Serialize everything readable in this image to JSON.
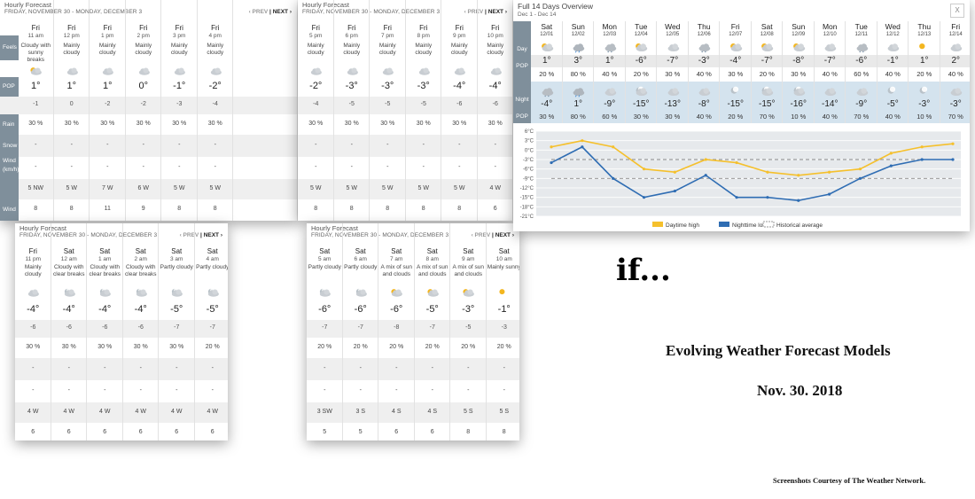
{
  "common": {
    "title": "Hourly Forecast",
    "subtitle": "FRIDAY, NOVEMBER 30 - MONDAY, DECEMBER 3",
    "prev": "‹ PREV",
    "next": "NEXT ›"
  },
  "labels": {
    "feels": "Feels like",
    "pop": "POP",
    "rain": "Rain",
    "snow": "Snow",
    "wind": "Wind (km/h)",
    "gust": "Wind gust (km/h)"
  },
  "p1": {
    "cols": [
      {
        "day": "Fri",
        "time": "11 am",
        "cond": "Cloudy with sunny breaks",
        "icon": "sun-cloud-icon",
        "temp": "1°",
        "feels": "-1",
        "pop": "30 %",
        "rain": "-",
        "snow": "-",
        "wind": "5 NW",
        "gust": "8"
      },
      {
        "day": "Fri",
        "time": "12 pm",
        "cond": "Mainly cloudy",
        "icon": "cloud-icon",
        "temp": "1°",
        "feels": "0",
        "pop": "30 %",
        "rain": "-",
        "snow": "-",
        "wind": "5 W",
        "gust": "8"
      },
      {
        "day": "Fri",
        "time": "1 pm",
        "cond": "Mainly cloudy",
        "icon": "cloud-icon",
        "temp": "1°",
        "feels": "-2",
        "pop": "30 %",
        "rain": "-",
        "snow": "-",
        "wind": "7 W",
        "gust": "11"
      },
      {
        "day": "Fri",
        "time": "2 pm",
        "cond": "Mainly cloudy",
        "icon": "cloud-icon",
        "temp": "0°",
        "feels": "-2",
        "pop": "30 %",
        "rain": "-",
        "snow": "-",
        "wind": "6 W",
        "gust": "9"
      },
      {
        "day": "Fri",
        "time": "3 pm",
        "cond": "Mainly cloudy",
        "icon": "cloud-icon",
        "temp": "-1°",
        "feels": "-3",
        "pop": "30 %",
        "rain": "-",
        "snow": "-",
        "wind": "5 W",
        "gust": "8"
      },
      {
        "day": "Fri",
        "time": "4 pm",
        "cond": "Mainly cloudy",
        "icon": "cloud-icon",
        "temp": "-2°",
        "feels": "-4",
        "pop": "30 %",
        "rain": "-",
        "snow": "-",
        "wind": "5 W",
        "gust": "8"
      }
    ]
  },
  "p2": {
    "cols": [
      {
        "day": "Fri",
        "time": "5 pm",
        "cond": "Mainly cloudy",
        "icon": "cloud-icon",
        "temp": "-2°",
        "feels": "-4",
        "pop": "30 %",
        "rain": "-",
        "snow": "-",
        "wind": "5 W",
        "gust": "8"
      },
      {
        "day": "Fri",
        "time": "6 pm",
        "cond": "Mainly cloudy",
        "icon": "cloud-icon",
        "temp": "-3°",
        "feels": "-5",
        "pop": "30 %",
        "rain": "-",
        "snow": "-",
        "wind": "5 W",
        "gust": "8"
      },
      {
        "day": "Fri",
        "time": "7 pm",
        "cond": "Mainly cloudy",
        "icon": "cloud-icon",
        "temp": "-3°",
        "feels": "-5",
        "pop": "30 %",
        "rain": "-",
        "snow": "-",
        "wind": "5 W",
        "gust": "8"
      },
      {
        "day": "Fri",
        "time": "8 pm",
        "cond": "Mainly cloudy",
        "icon": "cloud-icon",
        "temp": "-3°",
        "feels": "-5",
        "pop": "30 %",
        "rain": "-",
        "snow": "-",
        "wind": "5 W",
        "gust": "8"
      },
      {
        "day": "Fri",
        "time": "9 pm",
        "cond": "Mainly cloudy",
        "icon": "cloud-icon",
        "temp": "-4°",
        "feels": "-6",
        "pop": "30 %",
        "rain": "-",
        "snow": "-",
        "wind": "5 W",
        "gust": "8"
      },
      {
        "day": "Fri",
        "time": "10 pm",
        "cond": "Mainly cloudy",
        "icon": "cloud-icon",
        "temp": "-4°",
        "feels": "-6",
        "pop": "30 %",
        "rain": "-",
        "snow": "-",
        "wind": "4 W",
        "gust": "6"
      }
    ]
  },
  "p3": {
    "cols": [
      {
        "day": "Fri",
        "time": "11 pm",
        "cond": "Mainly cloudy",
        "icon": "cloud-icon",
        "temp": "-4°",
        "feels": "-6",
        "pop": "30 %",
        "rain": "-",
        "snow": "-",
        "wind": "4 W",
        "gust": "6"
      },
      {
        "day": "Sat",
        "time": "12 am",
        "cond": "Cloudy with clear breaks",
        "icon": "moon-cloud-icon",
        "temp": "-4°",
        "feels": "-6",
        "pop": "30 %",
        "rain": "-",
        "snow": "-",
        "wind": "4 W",
        "gust": "6"
      },
      {
        "day": "Sat",
        "time": "1 am",
        "cond": "Cloudy with clear breaks",
        "icon": "moon-cloud-icon",
        "temp": "-4°",
        "feels": "-6",
        "pop": "30 %",
        "rain": "-",
        "snow": "-",
        "wind": "4 W",
        "gust": "6"
      },
      {
        "day": "Sat",
        "time": "2 am",
        "cond": "Cloudy with clear breaks",
        "icon": "moon-cloud-icon",
        "temp": "-4°",
        "feels": "-6",
        "pop": "30 %",
        "rain": "-",
        "snow": "-",
        "wind": "4 W",
        "gust": "6"
      },
      {
        "day": "Sat",
        "time": "3 am",
        "cond": "Partly cloudy",
        "icon": "moon-cloud-icon",
        "temp": "-5°",
        "feels": "-7",
        "pop": "30 %",
        "rain": "-",
        "snow": "-",
        "wind": "4 W",
        "gust": "6"
      },
      {
        "day": "Sat",
        "time": "4 am",
        "cond": "Partly cloudy",
        "icon": "moon-cloud-icon",
        "temp": "-5°",
        "feels": "-7",
        "pop": "20 %",
        "rain": "-",
        "snow": "-",
        "wind": "4 W",
        "gust": "6"
      }
    ]
  },
  "p4": {
    "cols": [
      {
        "day": "Sat",
        "time": "5 am",
        "cond": "Partly cloudy",
        "icon": "moon-cloud-icon",
        "temp": "-6°",
        "feels": "-7",
        "pop": "20 %",
        "rain": "-",
        "snow": "-",
        "wind": "3 SW",
        "gust": "5"
      },
      {
        "day": "Sat",
        "time": "6 am",
        "cond": "Partly cloudy",
        "icon": "moon-cloud-icon",
        "temp": "-6°",
        "feels": "-7",
        "pop": "20 %",
        "rain": "-",
        "snow": "-",
        "wind": "3 S",
        "gust": "5"
      },
      {
        "day": "Sat",
        "time": "7 am",
        "cond": "A mix of sun and clouds",
        "icon": "sun-cloud-icon",
        "temp": "-6°",
        "feels": "-8",
        "pop": "20 %",
        "rain": "-",
        "snow": "-",
        "wind": "4 S",
        "gust": "6"
      },
      {
        "day": "Sat",
        "time": "8 am",
        "cond": "A mix of sun and clouds",
        "icon": "sun-cloud-icon",
        "temp": "-5°",
        "feels": "-7",
        "pop": "20 %",
        "rain": "-",
        "snow": "-",
        "wind": "4 S",
        "gust": "6"
      },
      {
        "day": "Sat",
        "time": "9 am",
        "cond": "A mix of sun and clouds",
        "icon": "sun-cloud-icon",
        "temp": "-3°",
        "feels": "-5",
        "pop": "20 %",
        "rain": "-",
        "snow": "-",
        "wind": "5 S",
        "gust": "8"
      },
      {
        "day": "Sat",
        "time": "10 am",
        "cond": "Mainly sunny",
        "icon": "sun-icon",
        "temp": "-1°",
        "feels": "-3",
        "pop": "20 %",
        "rain": "-",
        "snow": "-",
        "wind": "5 S",
        "gust": "8"
      }
    ]
  },
  "overview": {
    "title": "Full 14 Days Overview",
    "range": "Dec 1 - Dec 14",
    "close": "X",
    "day_label": "Day",
    "night_label": "Night",
    "pop_label": "POP",
    "days": [
      {
        "dow": "Sat",
        "date": "12/01",
        "day_icon": "sun-cloud-icon",
        "day_temp": "1°",
        "day_pop": "20 %",
        "night_icon": "snow-cloud-icon",
        "night_temp": "-4°",
        "night_pop": "30 %"
      },
      {
        "dow": "Sun",
        "date": "12/02",
        "day_icon": "rain-cloud-icon",
        "day_temp": "3°",
        "day_pop": "80 %",
        "night_icon": "rain-cloud-icon",
        "night_temp": "1°",
        "night_pop": "80 %"
      },
      {
        "dow": "Mon",
        "date": "12/03",
        "day_icon": "snow-cloud-icon",
        "day_temp": "1°",
        "day_pop": "40 %",
        "night_icon": "cloud-icon",
        "night_temp": "-9°",
        "night_pop": "60 %"
      },
      {
        "dow": "Tue",
        "date": "12/04",
        "day_icon": "sun-cloud-icon",
        "day_temp": "-6°",
        "day_pop": "20 %",
        "night_icon": "moon-cloud-icon",
        "night_temp": "-15°",
        "night_pop": "30 %"
      },
      {
        "dow": "Wed",
        "date": "12/05",
        "day_icon": "cloud-icon",
        "day_temp": "-7°",
        "day_pop": "30 %",
        "night_icon": "cloud-icon",
        "night_temp": "-13°",
        "night_pop": "30 %"
      },
      {
        "dow": "Thu",
        "date": "12/06",
        "day_icon": "snow-cloud-icon",
        "day_temp": "-3°",
        "day_pop": "40 %",
        "night_icon": "cloud-icon",
        "night_temp": "-8°",
        "night_pop": "40 %"
      },
      {
        "dow": "Fri",
        "date": "12/07",
        "day_icon": "sun-cloud-icon",
        "day_temp": "-4°",
        "day_pop": "30 %",
        "night_icon": "moon-icon",
        "night_temp": "-15°",
        "night_pop": "20 %"
      },
      {
        "dow": "Sat",
        "date": "12/08",
        "day_icon": "sun-cloud-icon",
        "day_temp": "-7°",
        "day_pop": "20 %",
        "night_icon": "moon-cloud-icon",
        "night_temp": "-15°",
        "night_pop": "70 %"
      },
      {
        "dow": "Sun",
        "date": "12/09",
        "day_icon": "sun-cloud-icon",
        "day_temp": "-8°",
        "day_pop": "30 %",
        "night_icon": "moon-cloud-icon",
        "night_temp": "-16°",
        "night_pop": "10 %"
      },
      {
        "dow": "Mon",
        "date": "12/10",
        "day_icon": "cloud-icon",
        "day_temp": "-7°",
        "day_pop": "40 %",
        "night_icon": "cloud-icon",
        "night_temp": "-14°",
        "night_pop": "40 %"
      },
      {
        "dow": "Tue",
        "date": "12/11",
        "day_icon": "snow-cloud-icon",
        "day_temp": "-6°",
        "day_pop": "60 %",
        "night_icon": "cloud-icon",
        "night_temp": "-9°",
        "night_pop": "70 %"
      },
      {
        "dow": "Wed",
        "date": "12/12",
        "day_icon": "cloud-icon",
        "day_temp": "-1°",
        "day_pop": "40 %",
        "night_icon": "moon-icon",
        "night_temp": "-5°",
        "night_pop": "40 %"
      },
      {
        "dow": "Thu",
        "date": "12/13",
        "day_icon": "sun-icon",
        "day_temp": "1°",
        "day_pop": "20 %",
        "night_icon": "moon-icon",
        "night_temp": "-3°",
        "night_pop": "10 %"
      },
      {
        "dow": "Fri",
        "date": "12/14",
        "day_icon": "cloud-icon",
        "day_temp": "2°",
        "day_pop": "40 %",
        "night_icon": "cloud-icon",
        "night_temp": "-3°",
        "night_pop": "70 %"
      }
    ]
  },
  "chart_data": {
    "type": "line",
    "x": [
      "12/01",
      "12/02",
      "12/03",
      "12/04",
      "12/05",
      "12/06",
      "12/07",
      "12/08",
      "12/09",
      "12/10",
      "12/11",
      "12/12",
      "12/13",
      "12/14"
    ],
    "y_ticks": [
      "6°C",
      "3°C",
      "0°C",
      "-3°C",
      "-6°C",
      "-9°C",
      "-12°C",
      "-15°C",
      "-18°C",
      "-21°C"
    ],
    "ylim": [
      -21,
      6
    ],
    "series": [
      {
        "name": "Daytime high",
        "color": "#f5c02c",
        "values": [
          1,
          3,
          1,
          -6,
          -7,
          -3,
          -4,
          -7,
          -8,
          -7,
          -6,
          -1,
          1,
          2
        ]
      },
      {
        "name": "Nighttime low",
        "color": "#2f6db3",
        "values": [
          -4,
          1,
          -9,
          -15,
          -13,
          -8,
          -15,
          -15,
          -16,
          -14,
          -9,
          -5,
          -3,
          -3
        ]
      }
    ],
    "historical_average": {
      "name": "Historical average",
      "values": [
        -3,
        -9
      ]
    },
    "grid": true,
    "legend_position": "bottom"
  },
  "text": {
    "if": "if...",
    "main": "Evolving Weather Forecast Models",
    "date": "Nov. 30. 2018",
    "credit": "Screenshots Courtesy of The Weather Network."
  }
}
